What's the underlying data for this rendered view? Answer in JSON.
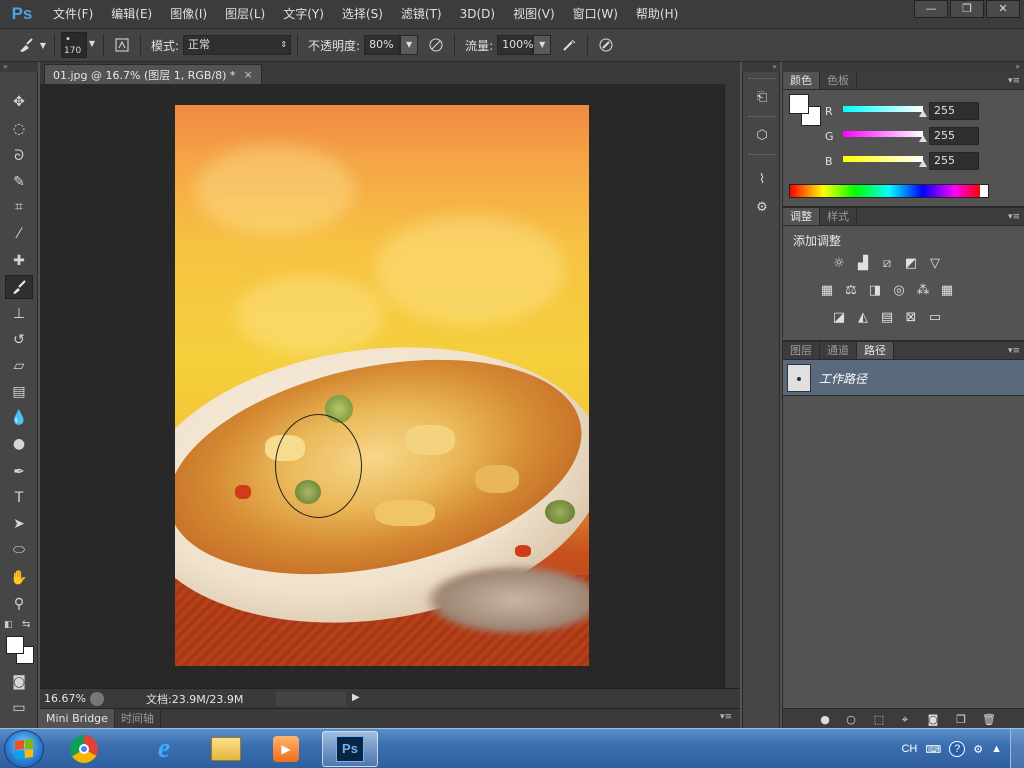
{
  "app": {
    "logo": "Ps"
  },
  "menu": [
    "文件(F)",
    "编辑(E)",
    "图像(I)",
    "图层(L)",
    "文字(Y)",
    "选择(S)",
    "滤镜(T)",
    "3D(D)",
    "视图(V)",
    "窗口(W)",
    "帮助(H)"
  ],
  "window_controls": {
    "minimize": "—",
    "restore": "❐",
    "close": "✕"
  },
  "options": {
    "brush_size": "170",
    "mode_label": "模式:",
    "mode_value": "正常",
    "opacity_label": "不透明度:",
    "opacity_value": "80%",
    "flow_label": "流量:",
    "flow_value": "100%"
  },
  "document": {
    "tab_title": "01.jpg @ 16.7% (图层 1, RGB/8) *",
    "tab_close": "×",
    "zoom": "16.67%",
    "doc_size": "文档:23.9M/23.9M"
  },
  "bottom_tabs": [
    "Mini Bridge",
    "时间轴"
  ],
  "color_panel": {
    "tabs": [
      "颜色",
      "色板"
    ],
    "channels": [
      {
        "label": "R",
        "value": "255",
        "gradient": [
          "#00ffff",
          "#ffffff"
        ]
      },
      {
        "label": "G",
        "value": "255",
        "gradient": [
          "#ff00ff",
          "#ffffff"
        ]
      },
      {
        "label": "B",
        "value": "255",
        "gradient": [
          "#ffff00",
          "#ffffff"
        ]
      }
    ],
    "foreground": "#ffffff",
    "background": "#ffffff"
  },
  "adjustments_panel": {
    "tabs": [
      "调整",
      "样式"
    ],
    "title": "添加调整"
  },
  "paths_panel": {
    "tabs": [
      "图层",
      "通道",
      "路径"
    ],
    "active_tab": "路径",
    "paths": [
      {
        "name": "工作路径"
      }
    ]
  },
  "taskbar": {
    "apps": [
      "chrome-like",
      "internet-explorer",
      "explorer",
      "media-player",
      "photoshop"
    ],
    "active_app": "photoshop",
    "photoshop_label": "Ps",
    "tray_lang": "CH"
  }
}
